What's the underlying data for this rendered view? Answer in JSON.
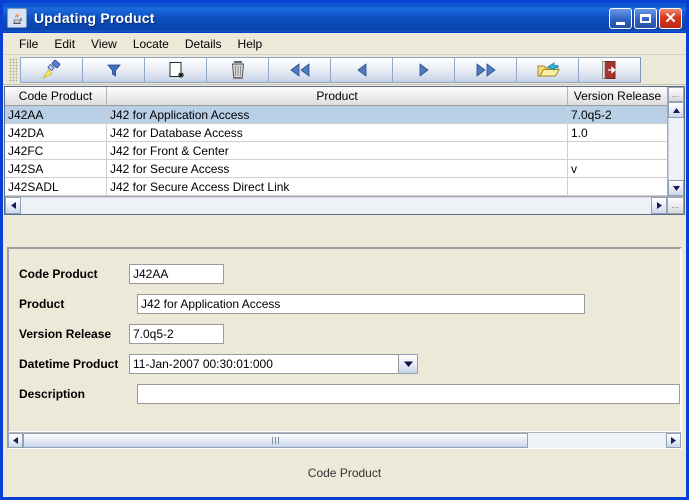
{
  "window": {
    "title": "Updating Product",
    "icon": "java-coffee-cup-icon",
    "controls": {
      "minimize": "minimize-button",
      "maximize": "maximize-button",
      "close_label": "✕"
    }
  },
  "menubar": {
    "items": [
      {
        "label": "File"
      },
      {
        "label": "Edit"
      },
      {
        "label": "View"
      },
      {
        "label": "Locate"
      },
      {
        "label": "Details"
      },
      {
        "label": "Help"
      }
    ]
  },
  "toolbar": {
    "buttons": [
      {
        "name": "search-flashlight-icon",
        "tooltip": "Search"
      },
      {
        "name": "filter-funnel-icon",
        "tooltip": "Filter"
      },
      {
        "name": "new-record-icon",
        "tooltip": "New"
      },
      {
        "name": "delete-trash-icon",
        "tooltip": "Delete"
      },
      {
        "name": "first-record-icon",
        "tooltip": "First"
      },
      {
        "name": "previous-record-icon",
        "tooltip": "Previous"
      },
      {
        "name": "next-record-icon",
        "tooltip": "Next"
      },
      {
        "name": "last-record-icon",
        "tooltip": "Last"
      },
      {
        "name": "open-folder-icon",
        "tooltip": "Open"
      },
      {
        "name": "exit-door-icon",
        "tooltip": "Exit"
      }
    ]
  },
  "table": {
    "columns": [
      "Code Product",
      "Product",
      "Version Release"
    ],
    "rows": [
      {
        "code": "J42AA",
        "product": "J42 for Application Access",
        "version": "7.0q5-2",
        "selected": true
      },
      {
        "code": "J42DA",
        "product": "J42 for Database Access",
        "version": "1.0",
        "selected": false
      },
      {
        "code": "J42FC",
        "product": "J42 for Front & Center",
        "version": "",
        "selected": false
      },
      {
        "code": "J42SA",
        "product": "J42 for Secure Access",
        "version": "v",
        "selected": false
      },
      {
        "code": "J42SADL",
        "product": "J42 for Secure Access Direct Link",
        "version": "",
        "selected": false
      }
    ],
    "scroll_corner_label": "…"
  },
  "form": {
    "fields": [
      {
        "label": "Code Product",
        "value": "J42AA"
      },
      {
        "label": "Product",
        "value": "J42 for Application Access"
      },
      {
        "label": "Version Release",
        "value": "7.0q5-2"
      },
      {
        "label": "Datetime Product",
        "value": "11-Jan-2007 00:30:01:000"
      },
      {
        "label": "Description",
        "value": ""
      }
    ]
  },
  "statusbar": {
    "text": "Code Product"
  },
  "colors": {
    "titlebar_blue": "#0a53c8",
    "window_border": "#0a3fd4",
    "face": "#ece9d8",
    "selection": "#b8cfe5",
    "close_red": "#d8381c"
  }
}
